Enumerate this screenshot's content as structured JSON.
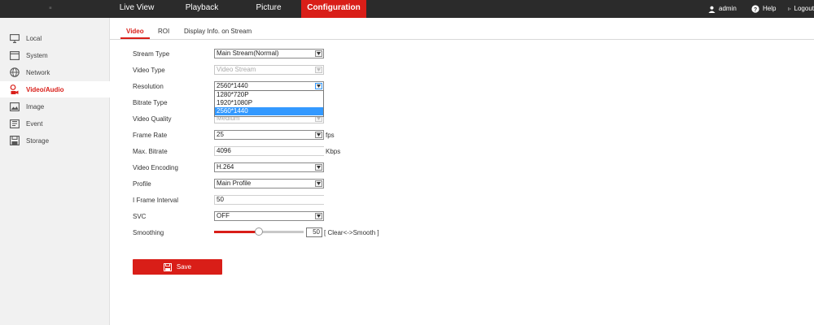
{
  "topnav": {
    "tabs": [
      {
        "label": "Live View"
      },
      {
        "label": "Playback"
      },
      {
        "label": "Picture"
      },
      {
        "label": "Configuration"
      }
    ],
    "user": "admin",
    "help": "Help",
    "logout": "Logout"
  },
  "sidebar": {
    "items": [
      {
        "label": "Local",
        "icon": "monitor-icon"
      },
      {
        "label": "System",
        "icon": "system-icon"
      },
      {
        "label": "Network",
        "icon": "globe-icon"
      },
      {
        "label": "Video/Audio",
        "icon": "video-audio-icon"
      },
      {
        "label": "Image",
        "icon": "image-icon"
      },
      {
        "label": "Event",
        "icon": "event-icon"
      },
      {
        "label": "Storage",
        "icon": "storage-icon"
      }
    ],
    "active": "Video/Audio"
  },
  "subtabs": [
    {
      "label": "Video"
    },
    {
      "label": "ROI"
    },
    {
      "label": "Display Info. on Stream"
    }
  ],
  "form": {
    "stream_type": {
      "label": "Stream Type",
      "value": "Main Stream(Normal)"
    },
    "video_type": {
      "label": "Video Type",
      "value": "Video Stream"
    },
    "resolution": {
      "label": "Resolution",
      "value": "2560*1440",
      "options": [
        "1280*720P",
        "1920*1080P",
        "2560*1440"
      ]
    },
    "bitrate_type": {
      "label": "Bitrate Type"
    },
    "video_quality": {
      "label": "Video Quality",
      "value": "Medium"
    },
    "frame_rate": {
      "label": "Frame Rate",
      "value": "25",
      "unit": "fps"
    },
    "max_bitrate": {
      "label": "Max. Bitrate",
      "value": "4096",
      "unit": "Kbps"
    },
    "video_encoding": {
      "label": "Video Encoding",
      "value": "H.264"
    },
    "profile": {
      "label": "Profile",
      "value": "Main Profile"
    },
    "i_frame_interval": {
      "label": "I Frame Interval",
      "value": "50"
    },
    "svc": {
      "label": "SVC",
      "value": "OFF"
    },
    "smoothing": {
      "label": "Smoothing",
      "value": "50",
      "level": 0.5,
      "hint": "[ Clear<->Smooth ]"
    }
  },
  "save_label": "Save",
  "colors": {
    "accent": "#d91e18",
    "topbar": "#2b2b2b",
    "selection": "#3399ff"
  }
}
